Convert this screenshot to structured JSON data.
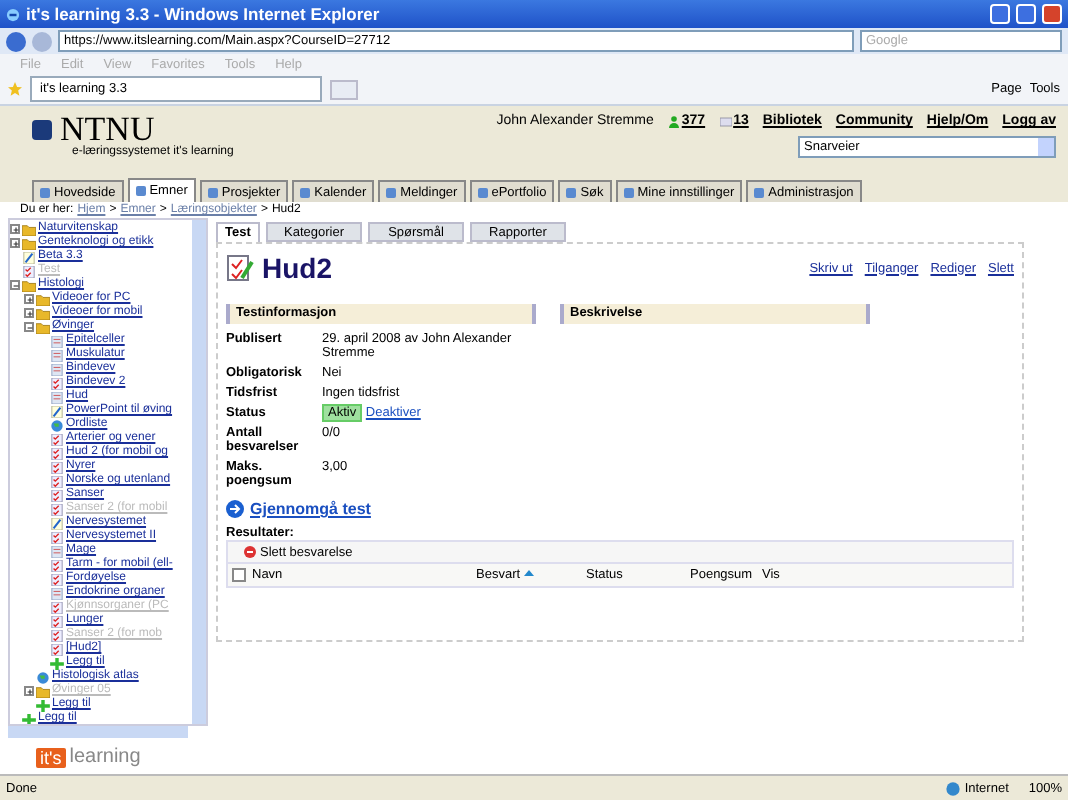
{
  "window": {
    "title": "it's learning 3.3 - Windows Internet Explorer"
  },
  "address_bar": {
    "url": "https://www.itslearning.com/Main.aspx?CourseID=27712",
    "search_placeholder": "Google"
  },
  "menu_bar": [
    "File",
    "Edit",
    "View",
    "Favorites",
    "Tools",
    "Help"
  ],
  "browser_tab": {
    "title": "it's learning 3.3"
  },
  "browser_tools": [
    "Page",
    "Tools"
  ],
  "header": {
    "logo": "NTNU",
    "subtitle": "e-læringssystemet it's learning",
    "user": "John Alexander Stremme",
    "online_count": "377",
    "message_count": "13",
    "links": [
      "Bibliotek",
      "Community",
      "Hjelp/Om",
      "Logg av"
    ],
    "shortcut_select": "Snarveier"
  },
  "nav_tabs": [
    {
      "label": "Hovedside",
      "selected": false
    },
    {
      "label": "Emner",
      "selected": true
    },
    {
      "label": "Prosjekter",
      "selected": false
    },
    {
      "label": "Kalender",
      "selected": false
    },
    {
      "label": "Meldinger",
      "selected": false
    },
    {
      "label": "ePortfolio",
      "selected": false
    },
    {
      "label": "Søk",
      "selected": false
    },
    {
      "label": "Mine innstillinger",
      "selected": false
    },
    {
      "label": "Administrasjon",
      "selected": false
    }
  ],
  "breadcrumb": {
    "label": "Du er her:",
    "separator": ">",
    "items": [
      "Hjem",
      "Emner",
      "Læringsobjekter"
    ],
    "current": "Hud2"
  },
  "tree": [
    {
      "label": "Naturvitenskap",
      "kind": "folder",
      "expanded": false,
      "disabled": false
    },
    {
      "label": "Genteknologi og etikk",
      "kind": "folder",
      "expanded": false,
      "disabled": false
    },
    {
      "label": "Beta 3.3",
      "kind": "survey",
      "disabled": false
    },
    {
      "label": "Test",
      "kind": "test",
      "disabled": true
    },
    {
      "label": "Histologi",
      "kind": "folder",
      "expanded": true,
      "disabled": false,
      "children": [
        {
          "label": "Videoer for PC",
          "kind": "folder",
          "expanded": false,
          "disabled": false
        },
        {
          "label": "Videoer for mobil",
          "kind": "folder",
          "expanded": false,
          "disabled": false
        },
        {
          "label": "Øvinger",
          "kind": "folder",
          "expanded": true,
          "disabled": false,
          "children": [
            {
              "label": "Epitelceller",
              "kind": "page",
              "disabled": false
            },
            {
              "label": "Muskulatur",
              "kind": "page",
              "disabled": false
            },
            {
              "label": "Bindevev",
              "kind": "page",
              "disabled": false
            },
            {
              "label": "Bindevev 2",
              "kind": "test",
              "disabled": false
            },
            {
              "label": "Hud",
              "kind": "page",
              "disabled": false
            },
            {
              "label": "PowerPoint til øving",
              "kind": "survey",
              "disabled": false
            },
            {
              "label": "Ordliste",
              "kind": "link",
              "disabled": false
            },
            {
              "label": "Arterier og vener",
              "kind": "test",
              "disabled": false
            },
            {
              "label": "Hud 2 (for mobil og",
              "kind": "test",
              "disabled": false
            },
            {
              "label": "Nyrer",
              "kind": "test",
              "disabled": false
            },
            {
              "label": "Norske og utenland",
              "kind": "test",
              "disabled": false
            },
            {
              "label": "Sanser",
              "kind": "test",
              "disabled": false
            },
            {
              "label": "Sanser 2 (for mobil",
              "kind": "test",
              "disabled": true
            },
            {
              "label": "Nervesystemet",
              "kind": "survey",
              "disabled": false
            },
            {
              "label": "Nervesystemet II",
              "kind": "test",
              "disabled": false
            },
            {
              "label": "Mage",
              "kind": "page",
              "disabled": false
            },
            {
              "label": "Tarm - for mobil (ell-",
              "kind": "test",
              "disabled": false
            },
            {
              "label": "Fordøyelse",
              "kind": "test",
              "disabled": false
            },
            {
              "label": "Endokrine organer",
              "kind": "page",
              "disabled": false
            },
            {
              "label": "Kjønnsorganer (PC",
              "kind": "test",
              "disabled": true
            },
            {
              "label": "Lunger",
              "kind": "test",
              "disabled": false
            },
            {
              "label": "Sanser 2 (for mob",
              "kind": "test",
              "disabled": true
            },
            {
              "label": "[Hud2]",
              "kind": "test",
              "disabled": false
            },
            {
              "label": "Legg til",
              "kind": "add",
              "disabled": false
            }
          ]
        },
        {
          "label": "Histologisk atlas",
          "kind": "link",
          "disabled": false
        },
        {
          "label": "Øvinger 05",
          "kind": "folder",
          "expanded": false,
          "disabled": true
        },
        {
          "label": "Legg til",
          "kind": "add",
          "disabled": false
        }
      ]
    },
    {
      "label": "Legg til",
      "kind": "add",
      "disabled": false
    }
  ],
  "footer_logo": {
    "badge": "it's",
    "text": "learning"
  },
  "content_tabs": [
    {
      "label": "Test",
      "selected": true
    },
    {
      "label": "Kategorier",
      "selected": false
    },
    {
      "label": "Spørsmål",
      "selected": false
    },
    {
      "label": "Rapporter",
      "selected": false
    }
  ],
  "test": {
    "title": "Hud2",
    "actions": [
      "Skriv ut",
      "Tilganger",
      "Rediger",
      "Slett"
    ],
    "info_header": "Testinformasjon",
    "description_header": "Beskrivelse",
    "fields": [
      {
        "label": "Publisert",
        "value": "29. april 2008 av John Alexander Stremme"
      },
      {
        "label": "Obligatorisk",
        "value": "Nei"
      },
      {
        "label": "Tidsfrist",
        "value": "Ingen tidsfrist"
      },
      {
        "label": "Status",
        "kind": "status",
        "value": "Aktiv",
        "link": "Deaktiver"
      },
      {
        "label": "Antall besvarelser",
        "value": "0/0"
      },
      {
        "label": "Maks. poengsum",
        "value": "3,00"
      }
    ],
    "review_link": "Gjennomgå test",
    "results_label": "Resultater:",
    "delete_button": "Slett besvarelse",
    "select_all_checked": false,
    "columns": [
      "Navn",
      "Besvart",
      "Status",
      "Poengsum",
      "Vis"
    ]
  },
  "status_bar": {
    "text": "Done",
    "zone": "Internet",
    "zoom": "100%"
  }
}
